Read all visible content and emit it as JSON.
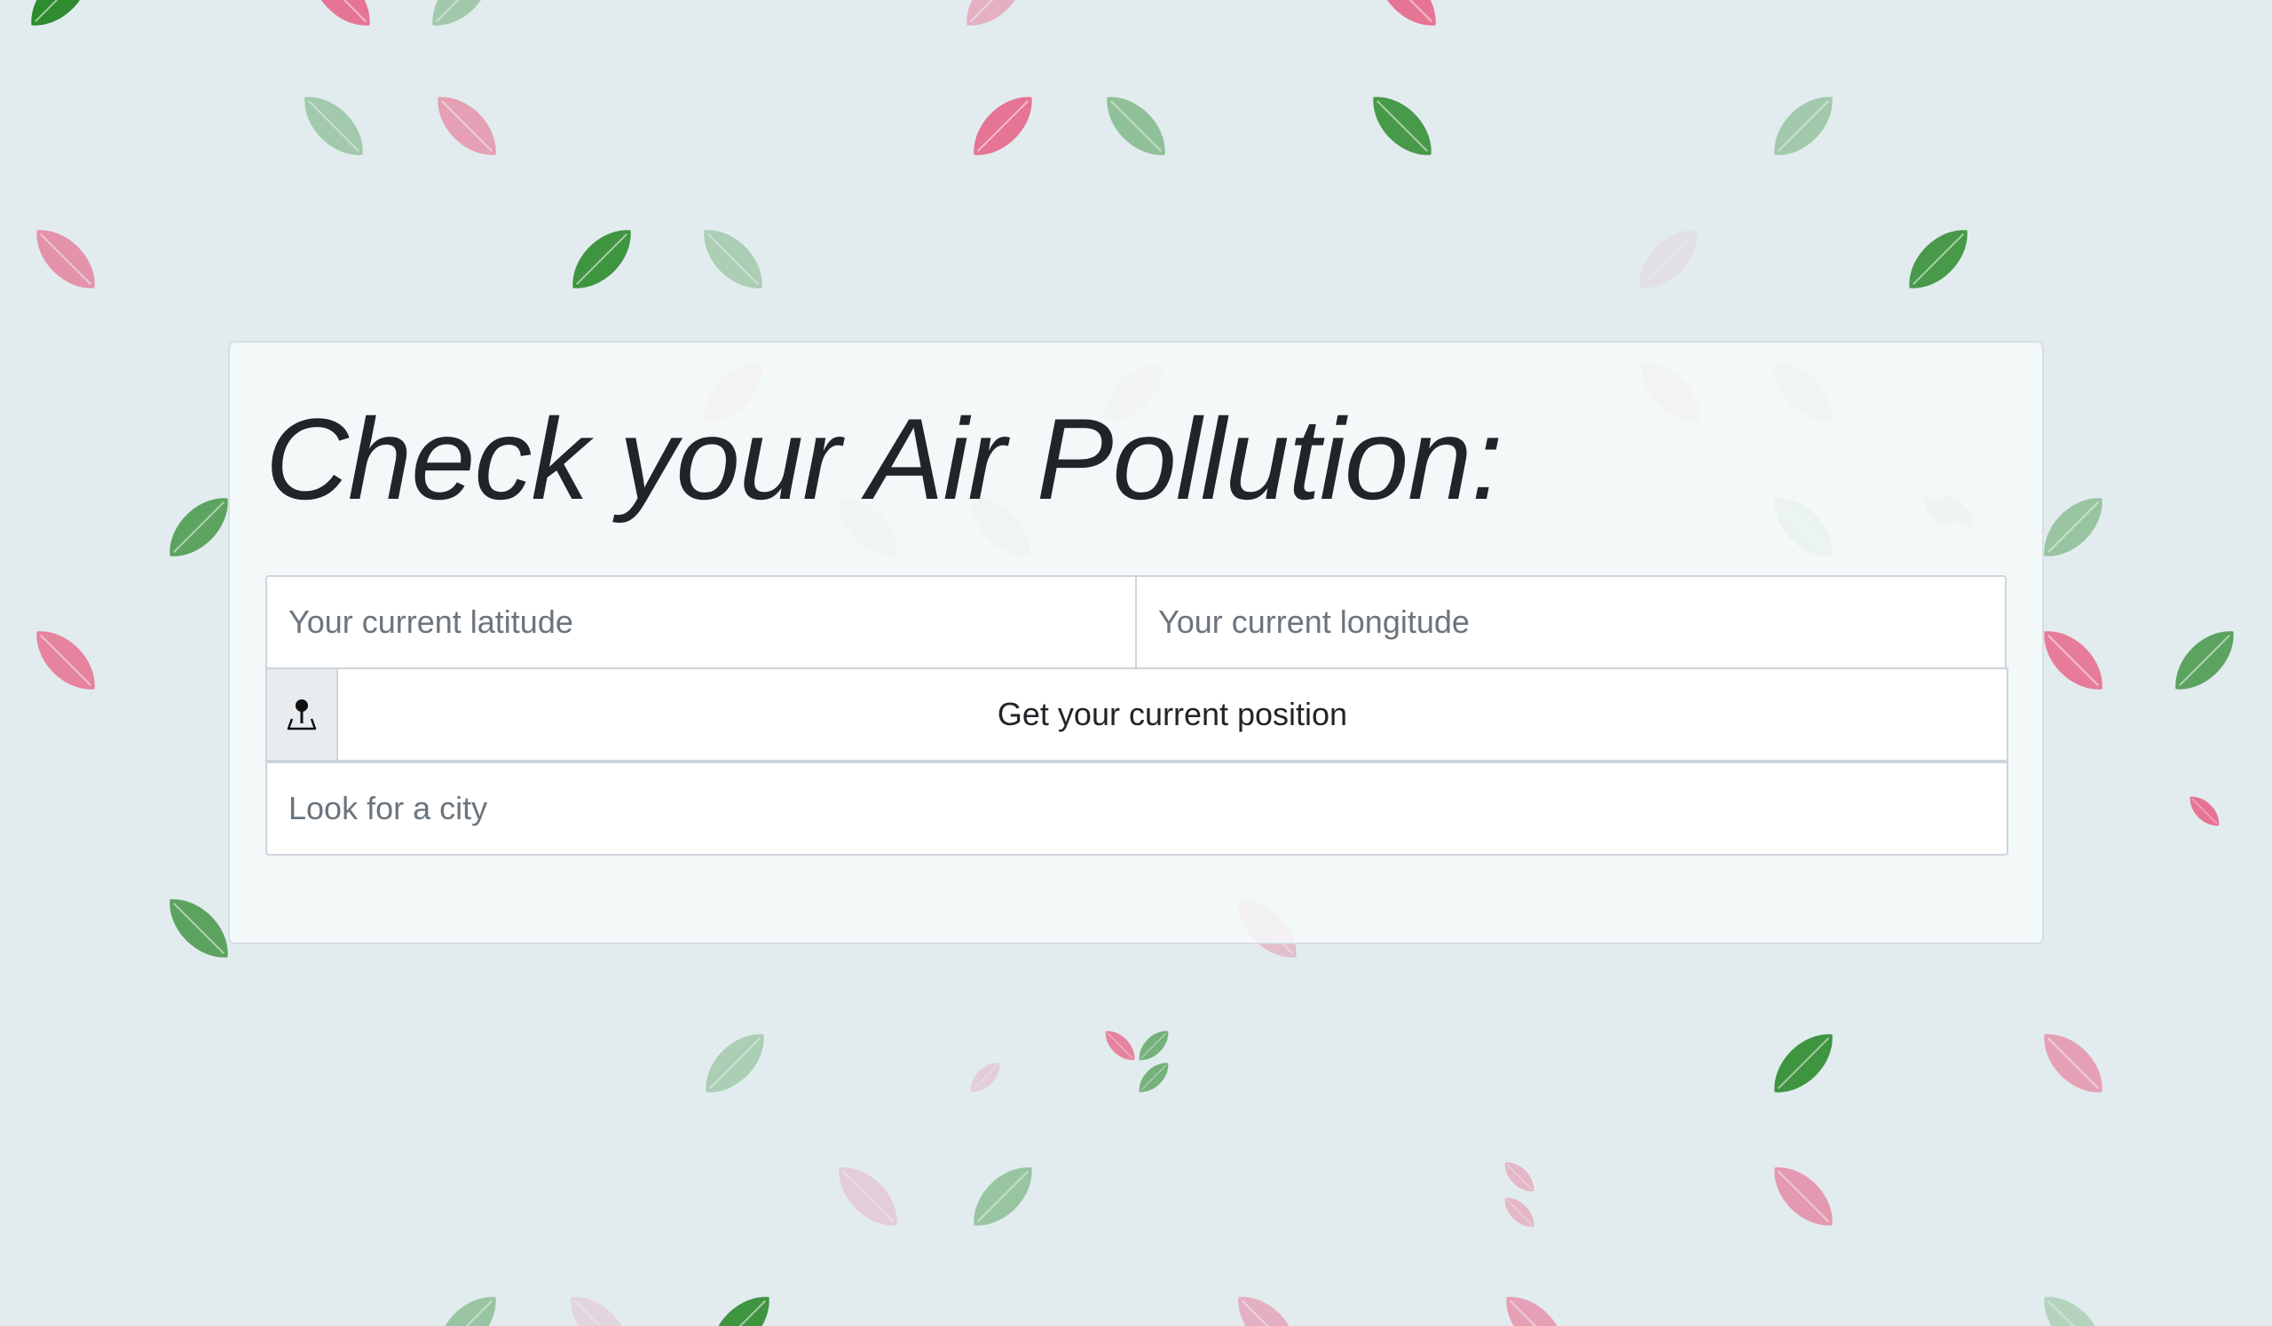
{
  "page": {
    "title": "Check your Air Pollution:"
  },
  "form": {
    "latitude_placeholder": "Your current latitude",
    "latitude_value": "",
    "longitude_placeholder": "Your current longitude",
    "longitude_value": "",
    "position_button_label": "Get your current position",
    "position_icon": "map-pin-icon",
    "city_placeholder": "Look for a city",
    "city_value": ""
  },
  "theme": {
    "background": "#e2ecef",
    "leaf_green": "#2e8b2e",
    "leaf_pink": "#e8577e",
    "card_background": "#f6f9fa",
    "text": "#212529",
    "placeholder": "#6c757d"
  },
  "decoration": {
    "leaf_pattern_icon": "leaf-icon"
  }
}
